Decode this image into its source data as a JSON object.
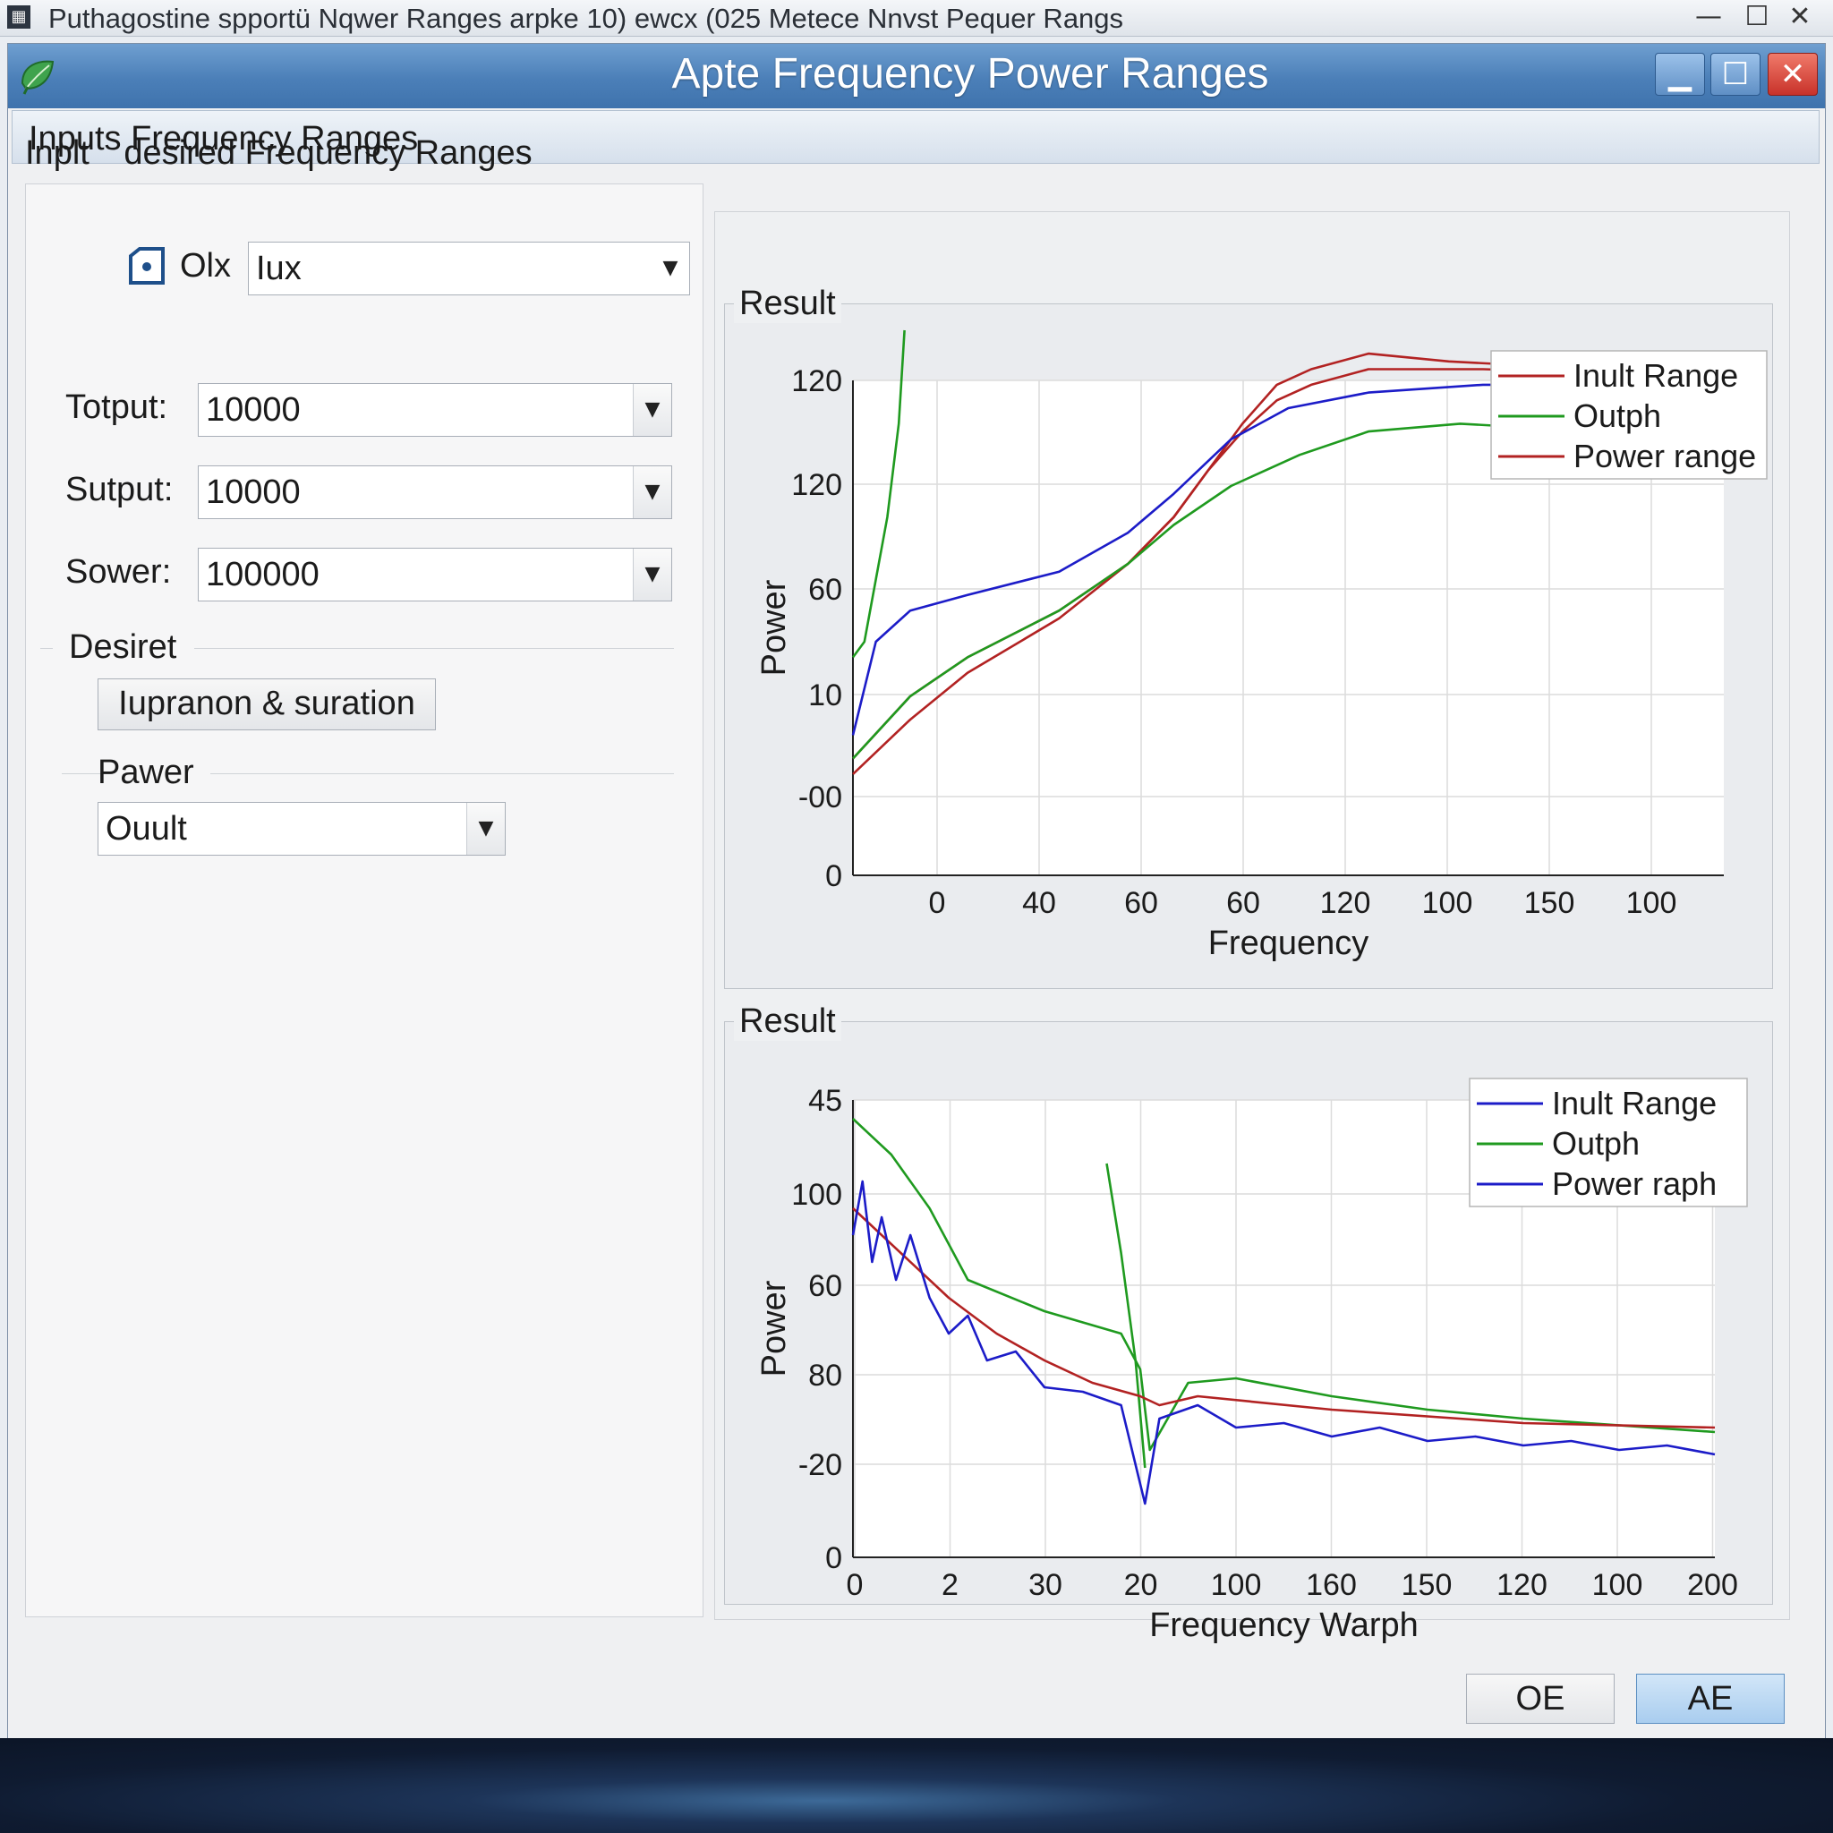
{
  "outer_window": {
    "title": "Puthagostine spportü Nqwer Ranges arpke 10) ewcx (025 Metece Nnvst Pequer Rangs",
    "icon_glyph": "▦",
    "controls": [
      "—",
      "☐",
      "✕"
    ]
  },
  "window": {
    "title": "Apte Frequency Power Ranges",
    "minimize": "▁",
    "maximize": "☐",
    "close": "✕",
    "icon": "leaf-icon"
  },
  "menu": {
    "label": "Inputs Frequency Ranges"
  },
  "inputs": {
    "heading_left": "Inplt",
    "heading_right": "desired Frequency Ranges",
    "top_combo": {
      "icon_label": "Olx",
      "value": "Iux"
    },
    "fields": [
      {
        "label": "Totput:",
        "value": "10000"
      },
      {
        "label": "Sutput:",
        "value": "10000"
      },
      {
        "label": "Sower:",
        "value": "100000"
      }
    ],
    "desired_section": "Desiret",
    "desired_button": "Iupranon & suration",
    "power_section": "Pawer",
    "power_combo_value": "Ouult"
  },
  "buttons": {
    "oe": "OE",
    "ae": "AE"
  },
  "colors": {
    "red": "#b22222",
    "green": "#1f9a1f",
    "blue": "#1c1cc8",
    "title_bar": "#4b7fb8"
  },
  "chart_data": [
    {
      "type": "line",
      "group_title": "Result",
      "xlabel": "Frequency",
      "ylabel": "Power",
      "x_tick_labels": [
        "0",
        "40",
        "60",
        "60",
        "120",
        "100",
        "150",
        "100"
      ],
      "y_tick_labels": [
        "120",
        "120",
        "60",
        "10",
        "-00",
        "0"
      ],
      "grid": true,
      "legend_position": "top-right",
      "legend": [
        {
          "name": "Inult Range",
          "color": "#b22222"
        },
        {
          "name": "Outph",
          "color": "#1f9a1f"
        },
        {
          "name": "Power range",
          "color": "#b22222"
        }
      ],
      "series": [
        {
          "color": "#b22222",
          "values": [
            [
              0,
              1.5
            ],
            [
              0.5,
              2.3
            ],
            [
              1,
              2.8
            ],
            [
              1.8,
              3.4
            ],
            [
              2.4,
              4.0
            ],
            [
              2.8,
              4.6
            ],
            [
              3.1,
              5.2
            ],
            [
              3.4,
              5.8
            ],
            [
              3.7,
              6.3
            ],
            [
              4.0,
              6.5
            ],
            [
              4.5,
              6.7
            ],
            [
              5.2,
              6.6
            ],
            [
              6.5,
              6.5
            ],
            [
              7.6,
              6.5
            ]
          ]
        },
        {
          "color": "#b22222",
          "values": [
            [
              0,
              1.3
            ],
            [
              0.5,
              2.0
            ],
            [
              1,
              2.6
            ],
            [
              1.8,
              3.3
            ],
            [
              2.4,
              4.0
            ],
            [
              2.8,
              4.6
            ],
            [
              3.1,
              5.2
            ],
            [
              3.4,
              5.7
            ],
            [
              3.7,
              6.1
            ],
            [
              4.0,
              6.3
            ],
            [
              4.5,
              6.5
            ],
            [
              5.5,
              6.5
            ],
            [
              7.6,
              6.4
            ]
          ]
        },
        {
          "color": "#1c1cc8",
          "values": [
            [
              0,
              1.8
            ],
            [
              0.2,
              3.0
            ],
            [
              0.5,
              3.4
            ],
            [
              1,
              3.6
            ],
            [
              1.8,
              3.9
            ],
            [
              2.4,
              4.4
            ],
            [
              2.8,
              4.9
            ],
            [
              3.3,
              5.6
            ],
            [
              3.8,
              6.0
            ],
            [
              4.5,
              6.2
            ],
            [
              5.5,
              6.3
            ],
            [
              7.6,
              6.3
            ]
          ]
        },
        {
          "color": "#1f9a1f",
          "values": [
            [
              0,
              1.5
            ],
            [
              0.5,
              2.3
            ],
            [
              1,
              2.8
            ],
            [
              1.8,
              3.4
            ],
            [
              2.4,
              4.0
            ],
            [
              2.8,
              4.5
            ],
            [
              3.3,
              5.0
            ],
            [
              3.9,
              5.4
            ],
            [
              4.5,
              5.7
            ],
            [
              5.3,
              5.8
            ],
            [
              6.5,
              5.7
            ],
            [
              7.6,
              5.6
            ]
          ]
        },
        {
          "color": "#1f9a1f",
          "values": [
            [
              0,
              2.8
            ],
            [
              0.1,
              3.0
            ],
            [
              0.2,
              3.8
            ],
            [
              0.3,
              4.6
            ],
            [
              0.4,
              5.8
            ],
            [
              0.45,
              7.0
            ]
          ]
        }
      ]
    },
    {
      "type": "line",
      "group_title": "Result",
      "xlabel": "Frequency Warph",
      "ylabel": "Power",
      "x_tick_labels": [
        "0",
        "2",
        "30",
        "20",
        "100",
        "160",
        "150",
        "120",
        "100",
        "200"
      ],
      "y_tick_labels": [
        "45",
        "100",
        "60",
        "80",
        "-20",
        "0"
      ],
      "grid": true,
      "legend_position": "top-right",
      "legend": [
        {
          "name": "Inult Range",
          "color": "#1c1cc8"
        },
        {
          "name": "Outph",
          "color": "#1f9a1f"
        },
        {
          "name": "Power raph",
          "color": "#1c1cc8"
        }
      ],
      "series": [
        {
          "color": "#1f9a1f",
          "values": [
            [
              0,
              4.9
            ],
            [
              0.4,
              4.5
            ],
            [
              0.8,
              3.9
            ],
            [
              1.2,
              3.1
            ],
            [
              2.0,
              2.75
            ],
            [
              2.8,
              2.5
            ],
            [
              3.0,
              2.1
            ],
            [
              3.1,
              1.2
            ],
            [
              3.5,
              1.95
            ],
            [
              4.0,
              2.0
            ],
            [
              5.0,
              1.8
            ],
            [
              6.0,
              1.65
            ],
            [
              7.0,
              1.55
            ],
            [
              9.0,
              1.4
            ]
          ]
        },
        {
          "color": "#1f9a1f",
          "values": [
            [
              2.65,
              4.4
            ],
            [
              2.8,
              3.4
            ],
            [
              2.95,
              2.2
            ],
            [
              3.05,
              1.0
            ]
          ]
        },
        {
          "color": "#b22222",
          "values": [
            [
              0,
              3.9
            ],
            [
              0.5,
              3.4
            ],
            [
              1,
              2.9
            ],
            [
              1.5,
              2.5
            ],
            [
              2.0,
              2.2
            ],
            [
              2.5,
              1.95
            ],
            [
              3.0,
              1.8
            ],
            [
              3.2,
              1.7
            ],
            [
              3.6,
              1.8
            ],
            [
              5.0,
              1.65
            ],
            [
              7.0,
              1.5
            ],
            [
              9.0,
              1.45
            ]
          ]
        },
        {
          "color": "#1c1cc8",
          "values": [
            [
              0,
              3.6
            ],
            [
              0.1,
              4.2
            ],
            [
              0.2,
              3.3
            ],
            [
              0.3,
              3.8
            ],
            [
              0.45,
              3.1
            ],
            [
              0.6,
              3.6
            ],
            [
              0.8,
              2.9
            ],
            [
              1.0,
              2.5
            ],
            [
              1.2,
              2.7
            ],
            [
              1.4,
              2.2
            ],
            [
              1.7,
              2.3
            ],
            [
              2.0,
              1.9
            ],
            [
              2.4,
              1.85
            ],
            [
              2.8,
              1.7
            ],
            [
              3.05,
              0.6
            ],
            [
              3.2,
              1.55
            ],
            [
              3.6,
              1.7
            ],
            [
              4.0,
              1.45
            ],
            [
              4.5,
              1.5
            ],
            [
              5.0,
              1.35
            ],
            [
              5.5,
              1.45
            ],
            [
              6.0,
              1.3
            ],
            [
              6.5,
              1.35
            ],
            [
              7.0,
              1.25
            ],
            [
              7.5,
              1.3
            ],
            [
              8.0,
              1.2
            ],
            [
              8.5,
              1.25
            ],
            [
              9.0,
              1.15
            ]
          ]
        }
      ]
    }
  ]
}
